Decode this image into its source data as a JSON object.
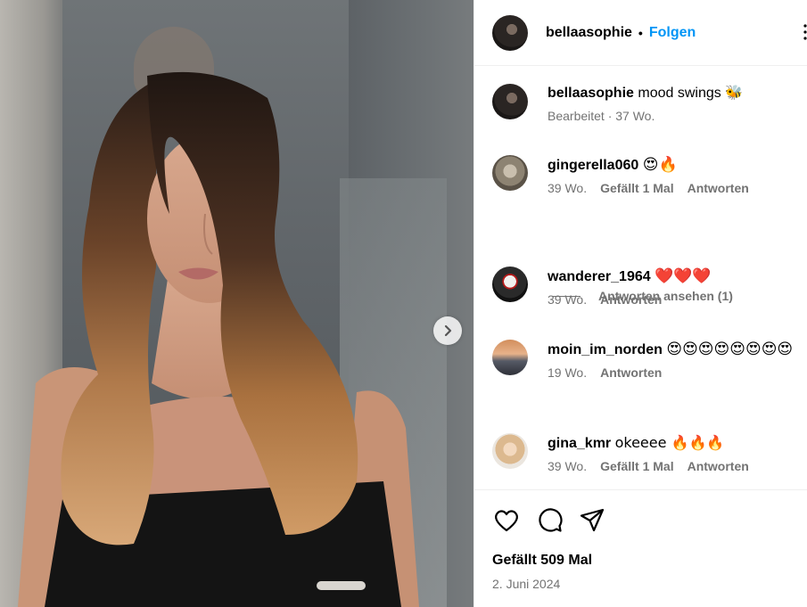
{
  "post": {
    "username": "bellaasophie",
    "separator": "•",
    "follow_label": "Folgen"
  },
  "caption": {
    "username": "bellaasophie",
    "text": "mood swings 🐝",
    "meta": "Bearbeitet · 37 Wo."
  },
  "comments": [
    {
      "username": "gingerella060",
      "text": "😍🔥",
      "time": "39 Wo.",
      "likes": "Gefällt 1 Mal",
      "reply": "Antworten"
    },
    {
      "username": "wanderer_1964",
      "text": "❤️❤️❤️",
      "time": "39 Wo.",
      "likes": "",
      "reply": "Antworten"
    },
    {
      "username": "moin_im_norden",
      "text": "😍😍😍😍😍😍😍😍",
      "time": "19 Wo.",
      "likes": "",
      "reply": "Antworten"
    },
    {
      "username": "gina_kmr",
      "text": "okeeee 🔥🔥🔥",
      "time": "39 Wo.",
      "likes": "Gefällt 1 Mal",
      "reply": "Antworten"
    }
  ],
  "view_replies_label": "Antworten ansehen (1)",
  "footer": {
    "likes_label": "Gefällt 509 Mal",
    "date": "2. Juni 2024"
  },
  "icons": {
    "like": "heart-icon",
    "comment": "comment-icon",
    "share": "paper-plane-icon",
    "next": "chevron-right-icon",
    "more": "more-icon"
  },
  "colors": {
    "accent": "#0095f6",
    "secondary_text": "#737373",
    "border": "#efefef"
  }
}
